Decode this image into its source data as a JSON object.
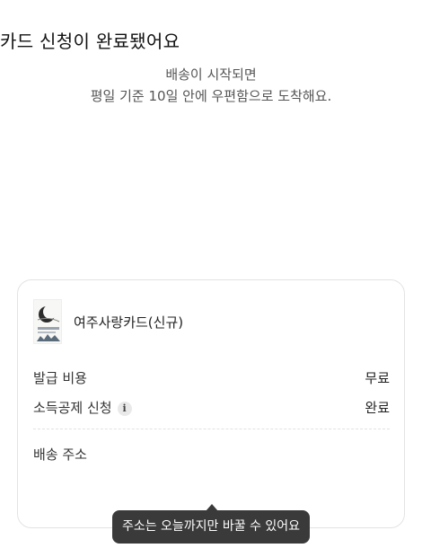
{
  "header": {
    "title": "카드 신청이 완료됐어요",
    "subtitle_line1": "배송이 시작되면",
    "subtitle_line2": "평일 기준 10일 안에 우편함으로 도착해요."
  },
  "card": {
    "name": "여주사랑카드(신규)",
    "rows": [
      {
        "label": "발급 비용",
        "value": "무료"
      },
      {
        "label": "소득공제 신청",
        "value": "완료",
        "info_icon": "info-icon"
      }
    ],
    "address_label": "배송 주소"
  },
  "tooltip": {
    "text": "주소는 오늘까지만 바꿀 수 있어요"
  }
}
